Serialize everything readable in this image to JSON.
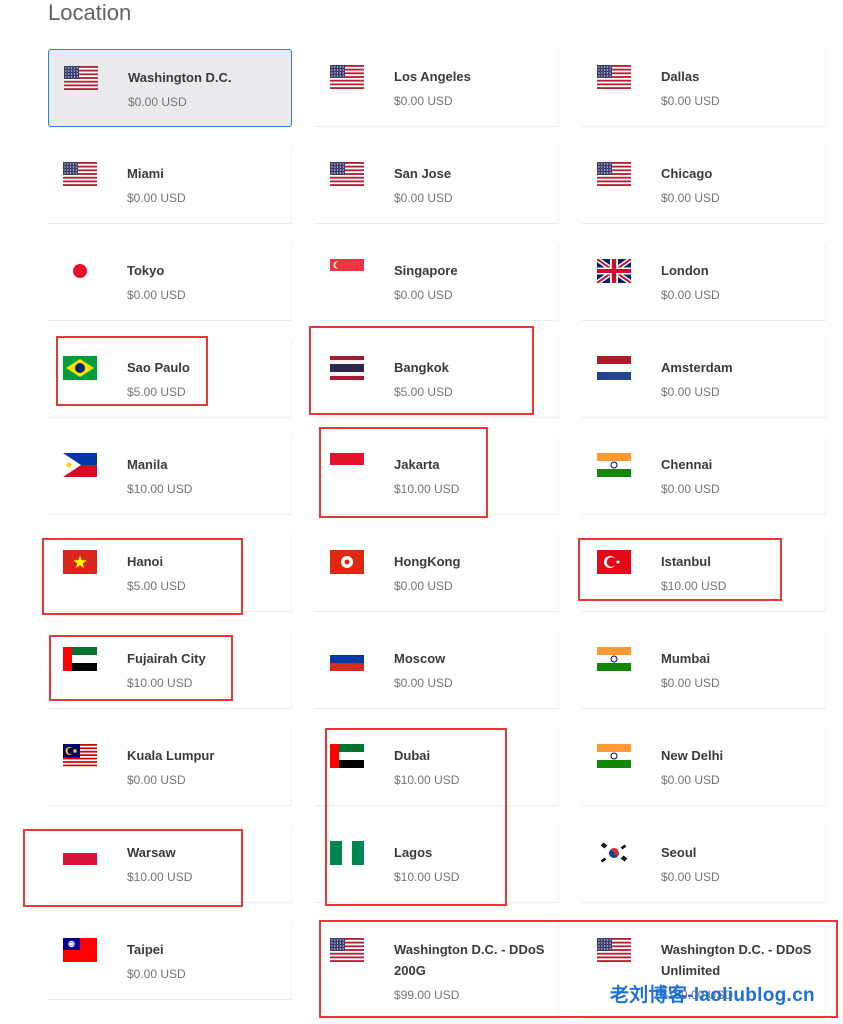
{
  "heading": "Location",
  "locations": [
    {
      "name": "Washington D.C.",
      "price": "$0.00 USD",
      "flag": "us-flag",
      "selected": true
    },
    {
      "name": "Los Angeles",
      "price": "$0.00 USD",
      "flag": "us-flag"
    },
    {
      "name": "Dallas",
      "price": "$0.00 USD",
      "flag": "us-flag"
    },
    {
      "name": "Miami",
      "price": "$0.00 USD",
      "flag": "us-flag"
    },
    {
      "name": "San Jose",
      "price": "$0.00 USD",
      "flag": "us-flag"
    },
    {
      "name": "Chicago",
      "price": "$0.00 USD",
      "flag": "us-flag"
    },
    {
      "name": "Tokyo",
      "price": "$0.00 USD",
      "flag": "jp-flag"
    },
    {
      "name": "Singapore",
      "price": "$0.00 USD",
      "flag": "sg-flag"
    },
    {
      "name": "London",
      "price": "$0.00 USD",
      "flag": "gb-flag"
    },
    {
      "name": "Sao Paulo",
      "price": "$5.00 USD",
      "flag": "br-flag"
    },
    {
      "name": "Bangkok",
      "price": "$5.00 USD",
      "flag": "th-flag"
    },
    {
      "name": "Amsterdam",
      "price": "$0.00 USD",
      "flag": "nl-flag"
    },
    {
      "name": "Manila",
      "price": "$10.00 USD",
      "flag": "ph-flag"
    },
    {
      "name": "Jakarta",
      "price": "$10.00 USD",
      "flag": "id-flag"
    },
    {
      "name": "Chennai",
      "price": "$0.00 USD",
      "flag": "in-flag"
    },
    {
      "name": "Hanoi",
      "price": "$5.00 USD",
      "flag": "vn-flag"
    },
    {
      "name": "HongKong",
      "price": "$0.00 USD",
      "flag": "hk-flag"
    },
    {
      "name": "Istanbul",
      "price": "$10.00 USD",
      "flag": "tr-flag"
    },
    {
      "name": "Fujairah City",
      "price": "$10.00 USD",
      "flag": "ae-flag"
    },
    {
      "name": "Moscow",
      "price": "$0.00 USD",
      "flag": "ru-flag"
    },
    {
      "name": "Mumbai",
      "price": "$0.00 USD",
      "flag": "in-flag"
    },
    {
      "name": "Kuala Lumpur",
      "price": "$0.00 USD",
      "flag": "my-flag"
    },
    {
      "name": "Dubai",
      "price": "$10.00 USD",
      "flag": "ae-flag"
    },
    {
      "name": "New Delhi",
      "price": "$0.00 USD",
      "flag": "in-flag"
    },
    {
      "name": "Warsaw",
      "price": "$10.00 USD",
      "flag": "pl-flag"
    },
    {
      "name": "Lagos",
      "price": "$10.00 USD",
      "flag": "ng-flag"
    },
    {
      "name": "Seoul",
      "price": "$0.00 USD",
      "flag": "kr-flag"
    },
    {
      "name": "Taipei",
      "price": "$0.00 USD",
      "flag": "tw-flag"
    },
    {
      "name": "Washington D.C. - DDoS 200G",
      "price": "$99.00 USD",
      "flag": "us-flag"
    },
    {
      "name": "Washington D.C. - DDoS Unlimited",
      "price": "$199.00 USD",
      "flag": "us-flag"
    }
  ],
  "watermark": "老刘博客-laoliublog.cn",
  "colors": {
    "highlight": "#e53935",
    "selected_border": "#2f7fe0",
    "selected_bg": "#e9ebee"
  }
}
